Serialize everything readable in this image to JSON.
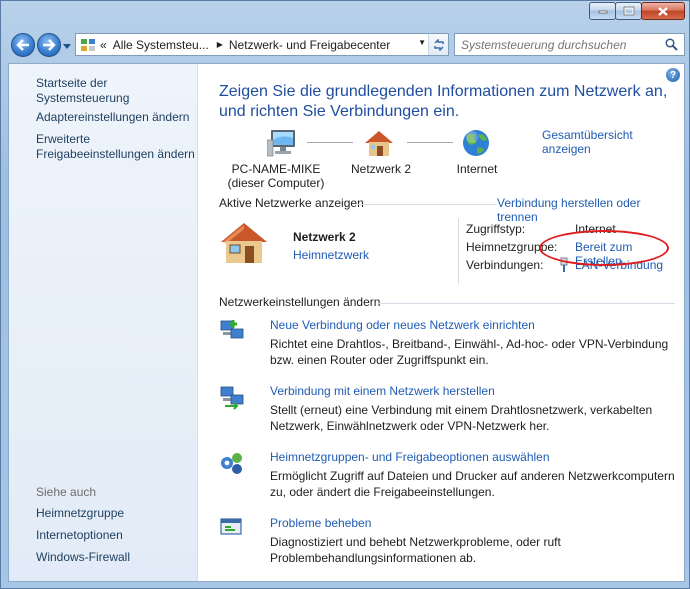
{
  "window": {
    "controls": {
      "minimize": "minimize",
      "maximize": "maximize",
      "close": "close"
    }
  },
  "address": {
    "prefix": "«",
    "segments": [
      "Alle Systemsteu...",
      "Netzwerk- und Freigabecenter"
    ],
    "search_placeholder": "Systemsteuerung durchsuchen"
  },
  "sidebar": {
    "links": [
      "Startseite der Systemsteuerung",
      "Adaptereinstellungen ändern",
      "Erweiterte Freigabeeinstellungen ändern"
    ],
    "see_also_header": "Siehe auch",
    "see_also": [
      "Heimnetzgruppe",
      "Internetoptionen",
      "Windows-Firewall"
    ]
  },
  "main": {
    "title": "Zeigen Sie die grundlegenden Informationen zum Netzwerk an, und richten Sie Verbindungen ein.",
    "map": {
      "nodes": [
        {
          "line1": "PC-NAME-MIKE",
          "line2": "(dieser Computer)"
        },
        {
          "line1": "Netzwerk 2",
          "line2": ""
        },
        {
          "line1": "Internet",
          "line2": ""
        }
      ],
      "overview_link": "Gesamtübersicht anzeigen"
    },
    "active": {
      "header": "Aktive Netzwerke anzeigen",
      "connect_link": "Verbindung herstellen oder trennen",
      "network_name": "Netzwerk 2",
      "network_type": "Heimnetzwerk",
      "access_label": "Zugriffstyp:",
      "access_value": "Internet",
      "homegroup_label": "Heimnetzgruppe:",
      "homegroup_value": "Bereit zum Erstellen",
      "connections_label": "Verbindungen:",
      "connections_value": "LAN-Verbindung"
    },
    "settings": {
      "header": "Netzwerkeinstellungen ändern",
      "tasks": [
        {
          "icon": "new-connection-icon",
          "link": "Neue Verbindung oder neues Netzwerk einrichten",
          "desc": "Richtet eine Drahtlos-, Breitband-, Einwähl-, Ad-hoc- oder VPN-Verbindung bzw. einen Router oder Zugriffspunkt ein."
        },
        {
          "icon": "connect-network-icon",
          "link": "Verbindung mit einem Netzwerk herstellen",
          "desc": "Stellt (erneut) eine Verbindung mit einem Drahtlosnetzwerk, verkabelten Netzwerk, Einwählnetzwerk oder VPN-Netzwerk her."
        },
        {
          "icon": "homegroup-icon",
          "link": "Heimnetzgruppen- und Freigabeoptionen auswählen",
          "desc": "Ermöglicht Zugriff auf Dateien und Drucker auf anderen Netzwerkcomputern zu, oder ändert die Freigabeeinstellungen."
        },
        {
          "icon": "troubleshoot-icon",
          "link": "Probleme beheben",
          "desc": "Diagnostiziert und behebt Netzwerkprobleme, oder ruft Problembehandlungsinformationen ab."
        }
      ]
    }
  },
  "colors": {
    "link": "#1f5cb4",
    "title": "#1f4ea0",
    "annotation": "#e11c1c"
  }
}
